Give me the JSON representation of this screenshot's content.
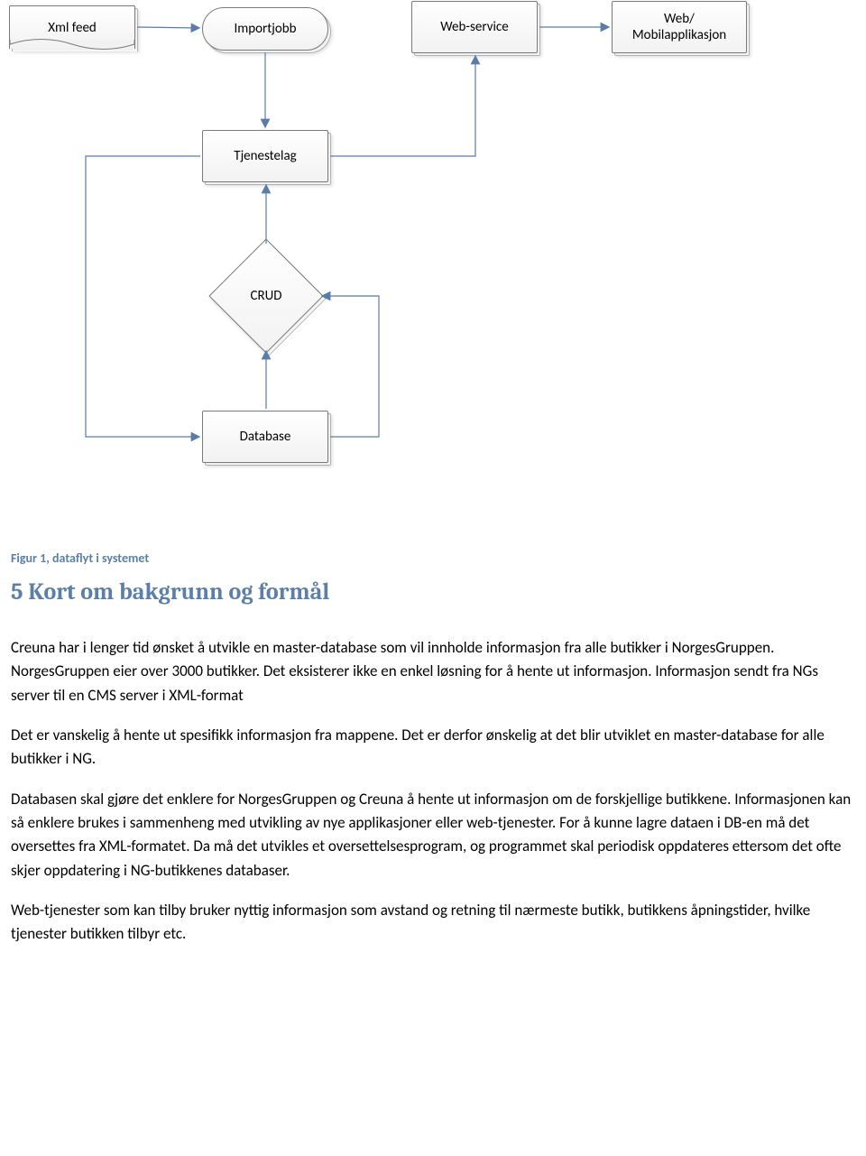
{
  "diagram": {
    "nodes": {
      "xmlfeed": "Xml feed",
      "importjobb": "Importjobb",
      "webservice": "Web-service",
      "webmobile_l1": "Web/",
      "webmobile_l2": "Mobilapplikasjon",
      "tjenestelag": "Tjenestelag",
      "crud": "CRUD",
      "database": "Database"
    }
  },
  "caption": "Figur 1, dataflyt i systemet",
  "heading": "5 Kort om bakgrunn og formål",
  "paragraphs": {
    "p1": "Creuna har i lenger tid ønsket å utvikle en master-database som vil innholde informasjon fra alle butikker i NorgesGruppen. NorgesGruppen eier over 3000 butikker. Det eksisterer ikke en enkel løsning for å hente ut informasjon. Informasjon sendt fra NGs server til en CMS server i XML-format",
    "p2": "Det er vanskelig å  hente ut spesifikk informasjon fra  mappene. Det er derfor ønskelig at det blir utviklet en master-database for alle butikker i NG.",
    "p3": "Databasen skal gjøre det enklere for NorgesGruppen og Creuna å hente ut informasjon om de forskjellige butikkene. Informasjonen kan så enklere brukes i sammenheng med utvikling av nye applikasjoner eller web-tjenester. For å kunne lagre dataen i DB-en må det oversettes fra XML-formatet. Da må det utvikles et oversettelsesprogram, og programmet skal periodisk oppdateres ettersom det ofte skjer oppdatering i NG-butikkenes databaser.",
    "p4": "Web-tjenester som kan tilby bruker nyttig informasjon som avstand og retning til nærmeste butikk, butikkens åpningstider, hvilke tjenester butikken tilbyr etc."
  }
}
